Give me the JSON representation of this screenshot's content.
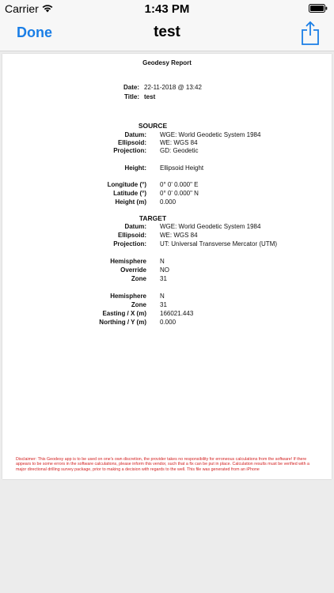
{
  "status_bar": {
    "carrier": "Carrier",
    "time": "1:43 PM"
  },
  "nav": {
    "done_label": "Done",
    "title": "test",
    "share_icon": "share-icon"
  },
  "report": {
    "heading": "Geodesy Report",
    "date_label": "Date:",
    "date_value": "22-11-2018 @ 13:42",
    "title_label": "Title:",
    "title_value": "test",
    "source": {
      "heading": "SOURCE",
      "datum_label": "Datum:",
      "datum_value": "WGE:  World Geodetic System 1984",
      "ellipsoid_label": "Ellipsoid:",
      "ellipsoid_value": "WE:  WGS 84",
      "projection_label": "Projection:",
      "projection_value": "GD: Geodetic",
      "height_label": "Height:",
      "height_value": "Ellipsoid Height",
      "longitude_label": "Longitude (°)",
      "longitude_value": "0° 0' 0.000\" E",
      "latitude_label": "Latitude (°)",
      "latitude_value": "0° 0' 0.000\" N",
      "heightm_label": "Height (m)",
      "heightm_value": "0.000"
    },
    "target": {
      "heading": "TARGET",
      "datum_label": "Datum:",
      "datum_value": "WGE:  World Geodetic System 1984",
      "ellipsoid_label": "Ellipsoid:",
      "ellipsoid_value": "WE:  WGS 84",
      "projection_label": "Projection:",
      "projection_value": "UT: Universal Transverse Mercator (UTM)",
      "hemisphere1_label": "Hemisphere",
      "hemisphere1_value": "N",
      "override_label": "Override",
      "override_value": "NO",
      "zone1_label": "Zone",
      "zone1_value": "31",
      "hemisphere2_label": "Hemisphere",
      "hemisphere2_value": "N",
      "zone2_label": "Zone",
      "zone2_value": "31",
      "easting_label": "Easting / X (m)",
      "easting_value": "166021.443",
      "northing_label": "Northing / Y (m)",
      "northing_value": "0.000"
    },
    "disclaimer": "Disclaimer:  This Geodesy app is to be used on one's own discretion, the provider takes no responsibility for erroneous calculations from the software! If there appears to be some errors in the software calculations, please inform this vendor, such that a fix can be put in place. Calculation results must be verified with a major directional drilling survey package, prior to making a decision with regards to the well. This file was generated from an iPhone"
  },
  "colors": {
    "accent": "#1a7ee6",
    "disclaimer": "#d32020"
  }
}
